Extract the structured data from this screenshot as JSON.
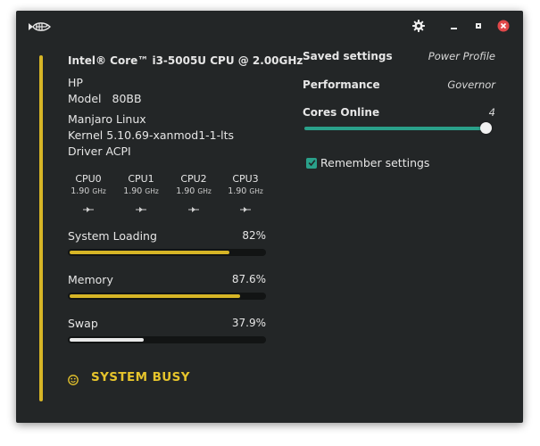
{
  "colors": {
    "background": "#232627",
    "accent_yellow": "#d6b526",
    "accent_teal": "#2aa08a",
    "text": "#e6e6e6",
    "close_red": "#e0484a"
  },
  "titlebar": {
    "icons": [
      "fish-logo-icon",
      "gear-icon",
      "minimize-icon",
      "maximize-icon",
      "close-icon"
    ]
  },
  "system": {
    "cpu_model": "Intel® Core™ i3-5005U CPU @ 2.00GHz",
    "vendor": "HP",
    "model_label": "Model",
    "model_value": "80BB",
    "os": "Manjaro Linux",
    "kernel": "Kernel 5.10.69-xanmod1-1-lts",
    "driver": "Driver ACPI"
  },
  "cores": [
    {
      "name": "CPU0",
      "freq": "1.90",
      "unit": "GHz"
    },
    {
      "name": "CPU1",
      "freq": "1.90",
      "unit": "GHz"
    },
    {
      "name": "CPU2",
      "freq": "1.90",
      "unit": "GHz"
    },
    {
      "name": "CPU3",
      "freq": "1.90",
      "unit": "GHz"
    }
  ],
  "meters": {
    "loading": {
      "label": "System Loading",
      "value": "82%",
      "fraction": 0.82
    },
    "memory": {
      "label": "Memory",
      "value": "87.6%",
      "fraction": 0.876
    },
    "swap": {
      "label": "Swap",
      "value": "37.9%",
      "fraction": 0.379
    }
  },
  "status": {
    "text": "SYSTEM BUSY",
    "icon": "smiley-icon"
  },
  "settings": {
    "saved_label": "Saved settings",
    "saved_value": "Power Profile",
    "performance_label": "Performance",
    "performance_value": "Governor",
    "cores_online_label": "Cores Online",
    "cores_online_value": "4",
    "cores_online_fraction": 1.0,
    "remember_label": "Remember settings",
    "remember_checked": true
  }
}
